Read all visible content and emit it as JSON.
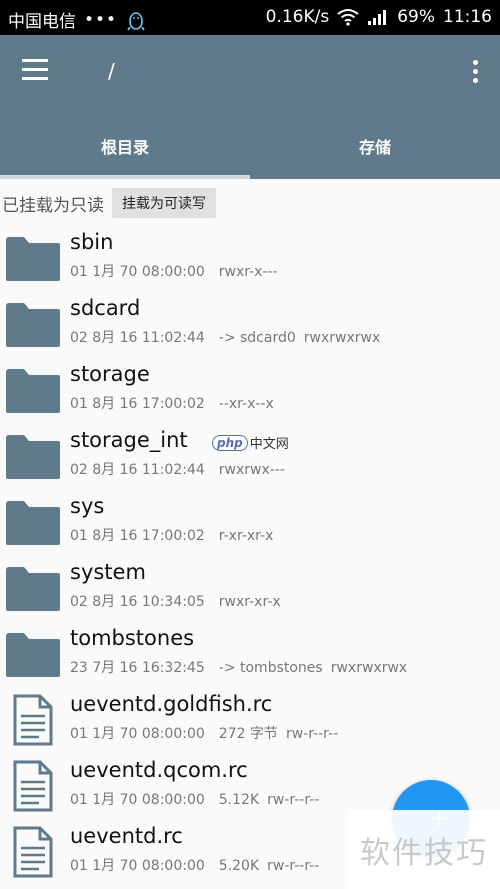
{
  "status_bar": {
    "carrier": "中国电信",
    "dots": "•••",
    "speed": "0.16K/s",
    "battery": "69%",
    "time": "11:16"
  },
  "app_bar": {
    "path": "/"
  },
  "tabs": [
    {
      "label": "根目录",
      "active": true
    },
    {
      "label": "存储",
      "active": false
    }
  ],
  "mount": {
    "status": "已挂载为只读",
    "button": "挂载为可读写"
  },
  "files": [
    {
      "name": "sbin",
      "type": "folder",
      "date": "01 1月 70 08:00:00",
      "link": "",
      "perms": "rwxr-x---"
    },
    {
      "name": "sdcard",
      "type": "folder",
      "date": "02 8月 16 11:02:44",
      "link": "-> sdcard0",
      "perms": "rwxrwxrwx"
    },
    {
      "name": "storage",
      "type": "folder",
      "date": "01 8月 16 17:00:02",
      "link": "",
      "perms": "--xr-x--x"
    },
    {
      "name": "storage_int",
      "type": "folder",
      "date": "02 8月 16 11:02:44",
      "link": "",
      "perms": "rwxrwx---"
    },
    {
      "name": "sys",
      "type": "folder",
      "date": "01 8月 16 17:00:02",
      "link": "",
      "perms": "r-xr-xr-x"
    },
    {
      "name": "system",
      "type": "folder",
      "date": "02 8月 16 10:34:05",
      "link": "",
      "perms": "rwxr-xr-x"
    },
    {
      "name": "tombstones",
      "type": "folder",
      "date": "23 7月 16 16:32:45",
      "link": "-> tombstones",
      "perms": "rwxrwxrwx"
    },
    {
      "name": "ueventd.goldfish.rc",
      "type": "file",
      "date": "01 1月 70 08:00:00",
      "link": "272 字节",
      "perms": "rw-r--r--"
    },
    {
      "name": "ueventd.qcom.rc",
      "type": "file",
      "date": "01 1月 70 08:00:00",
      "link": "5.12K",
      "perms": "rw-r--r--"
    },
    {
      "name": "ueventd.rc",
      "type": "file",
      "date": "01 1月 70 08:00:00",
      "link": "5.20K",
      "perms": "rw-r--r--"
    }
  ],
  "watermarks": {
    "php": "php",
    "php_cn": "中文网",
    "corner": "软件技巧"
  },
  "colors": {
    "toolbar": "#5f7a8b",
    "folder": "#5f7a8b",
    "fab": "#2196f3"
  }
}
